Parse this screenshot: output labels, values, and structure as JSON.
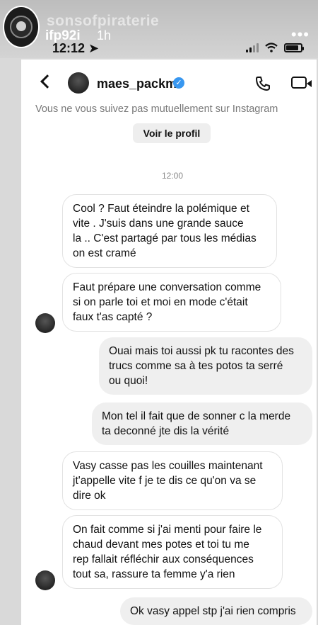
{
  "story": {
    "brand": "sonsofpiraterie",
    "username": "ifp92i",
    "time_ago": "1h",
    "more": "•••"
  },
  "status_bar": {
    "time": "12:12 ➤"
  },
  "header": {
    "name": "maes_packm",
    "verified": "✓"
  },
  "notice": "Vous ne vous suivez pas mutuellement sur Instagram",
  "profile_button": "Voir le profil",
  "timestamp": "12:00",
  "messages": [
    {
      "side": "in",
      "text": "Cool ? Faut éteindre la polémique et\nvite . J'suis dans une grande sauce\nla .. C'est partagé par tous les médias\non est cramé"
    },
    {
      "side": "in",
      "text": "Faut prépare une conversation comme\nsi on parle toi et moi en mode c'était\nfaux t'as capté ?"
    },
    {
      "side": "out",
      "text": "Ouai mais toi aussi pk tu racontes des\ntrucs comme sa à tes potos ta serré\nou quoi!"
    },
    {
      "side": "out",
      "text": "Mon tel il fait que de sonner c la merde\nta deconné jte dis la vérité"
    },
    {
      "side": "in",
      "text": "Vasy casse pas les couilles maintenant\njt'appelle vite f je te dis ce qu'on va se\ndire ok"
    },
    {
      "side": "in",
      "text": "On fait comme si j'ai menti pour faire le\nchaud devant mes potes et toi tu me\nrep fallait réfléchir aux conséquences\ntout sa, rassure ta femme y'a rien"
    },
    {
      "side": "out",
      "text": "Ok vasy appel stp j'ai rien compris"
    }
  ]
}
